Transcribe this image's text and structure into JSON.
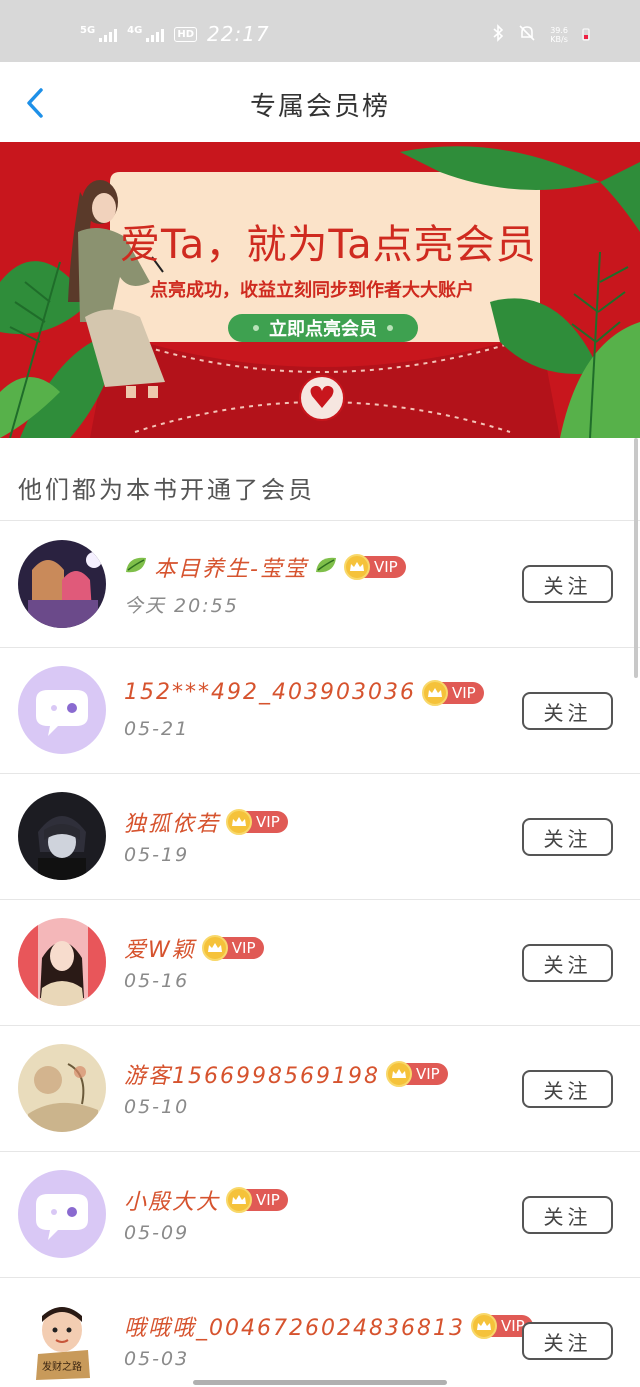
{
  "status_bar": {
    "signal1_label": "5G",
    "signal2_label": "4G",
    "hd_label": "HD",
    "time": "22:17",
    "net_speed_value": "39.6",
    "net_speed_unit": "KB/s"
  },
  "nav": {
    "title": "专属会员榜"
  },
  "banner": {
    "headline": "爱Ta，就为Ta点亮会员",
    "subtitle": "点亮成功，收益立刻同步到作者大大账户",
    "cta_label": "立即点亮会员"
  },
  "section": {
    "title": "他们都为本书开通了会员"
  },
  "vip_label": "VIP",
  "follow_label": "关注",
  "members": [
    {
      "name": "本目养生-莹莹",
      "date": "今天 20:55",
      "leaf_icons": true,
      "avatar": "anime-couple"
    },
    {
      "name": "152***492_403903036",
      "date": "05-21",
      "leaf_icons": false,
      "avatar": "default-chat"
    },
    {
      "name": "独孤依若",
      "date": "05-19",
      "leaf_icons": false,
      "avatar": "dark-anime"
    },
    {
      "name": "爱W颖",
      "date": "05-16",
      "leaf_icons": false,
      "avatar": "portrait-woman"
    },
    {
      "name": "游客1566998569198",
      "date": "05-10",
      "leaf_icons": false,
      "avatar": "ink-painting"
    },
    {
      "name": "小殷大大",
      "date": "05-09",
      "leaf_icons": false,
      "avatar": "default-chat"
    },
    {
      "name": "哦哦哦_004672602483681​3",
      "date": "05-03",
      "leaf_icons": false,
      "avatar": "baby-meme"
    }
  ],
  "colors": {
    "name_color": "#d6532e",
    "vip_red": "#e05a55",
    "crown_gold": "#f5c23a",
    "banner_red": "#c8161d",
    "cta_green": "#3ea150",
    "default_avatar_purple": "#d9c8f5"
  }
}
